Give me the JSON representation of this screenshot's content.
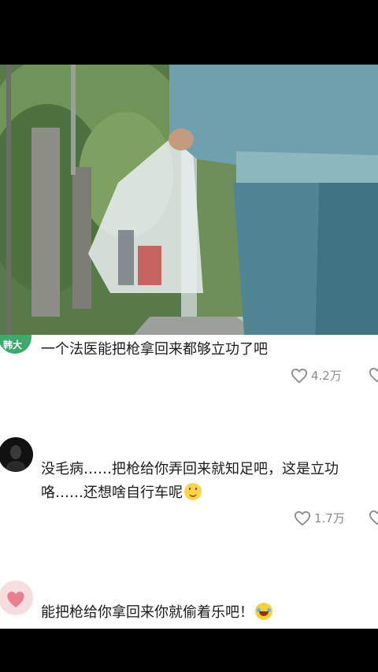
{
  "comments": [
    {
      "avatar_text": "韩大",
      "text": "一个法医能把枪拿回来都够立功了吧",
      "likes": "4.2万"
    },
    {
      "text_line1": "没毛病……把枪给你弄回来就知足吧，这是立功",
      "text_line2": "咯……还想啥自行车呢",
      "likes": "1.7万"
    },
    {
      "text": "能把枪给你拿回来你就偷着乐吧！"
    }
  ],
  "colors": {
    "like_gray": "#8a8a8a",
    "text": "#1b1b1b"
  },
  "icons": [
    "heart-icon",
    "smile-emoji-icon",
    "laugh-cry-emoji-icon"
  ]
}
